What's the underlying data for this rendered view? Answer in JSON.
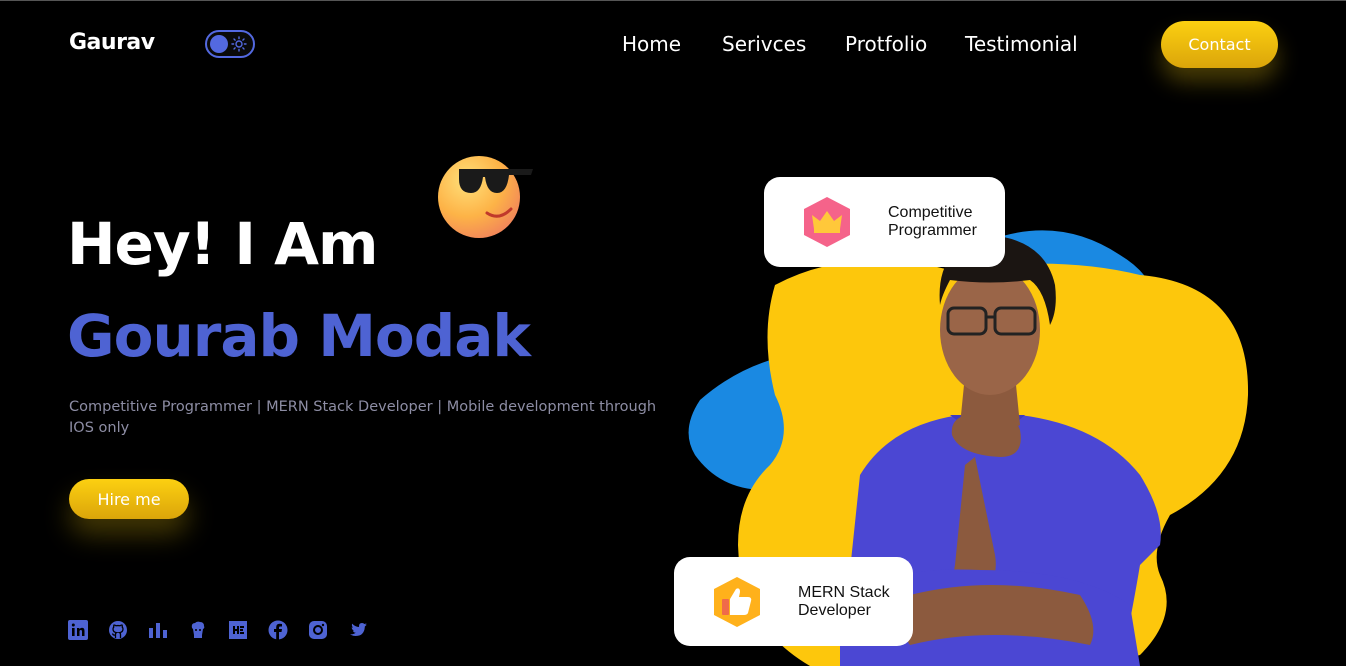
{
  "nav": {
    "logo": "Gaurav",
    "links": [
      "Home",
      "Serivces",
      "Protfolio",
      "Testimonial"
    ],
    "contact_label": "Contact"
  },
  "hero": {
    "greeting": "Hey! I Am",
    "name": "Gourab Modak",
    "subtitle": "Competitive Programmer | MERN Stack Developer | Mobile development through IOS only",
    "hire_label": "Hire me"
  },
  "badges": [
    {
      "line1": "Competitive",
      "line2": "Programmer",
      "icon": "crown-icon"
    },
    {
      "line1": "MERN Stack",
      "line2": "Developer",
      "icon": "thumbs-up-icon"
    }
  ],
  "socials": [
    "linkedin-icon",
    "github-icon",
    "stats-icon",
    "codechef-icon",
    "hackerearth-icon",
    "facebook-icon",
    "instagram-icon",
    "twitter-icon"
  ],
  "colors": {
    "accent_blue": "#4e63d3",
    "accent_yellow": "#fcd011",
    "blob_blue": "#1a89e2",
    "blob_yellow": "#fdc70c",
    "background": "#000000"
  }
}
